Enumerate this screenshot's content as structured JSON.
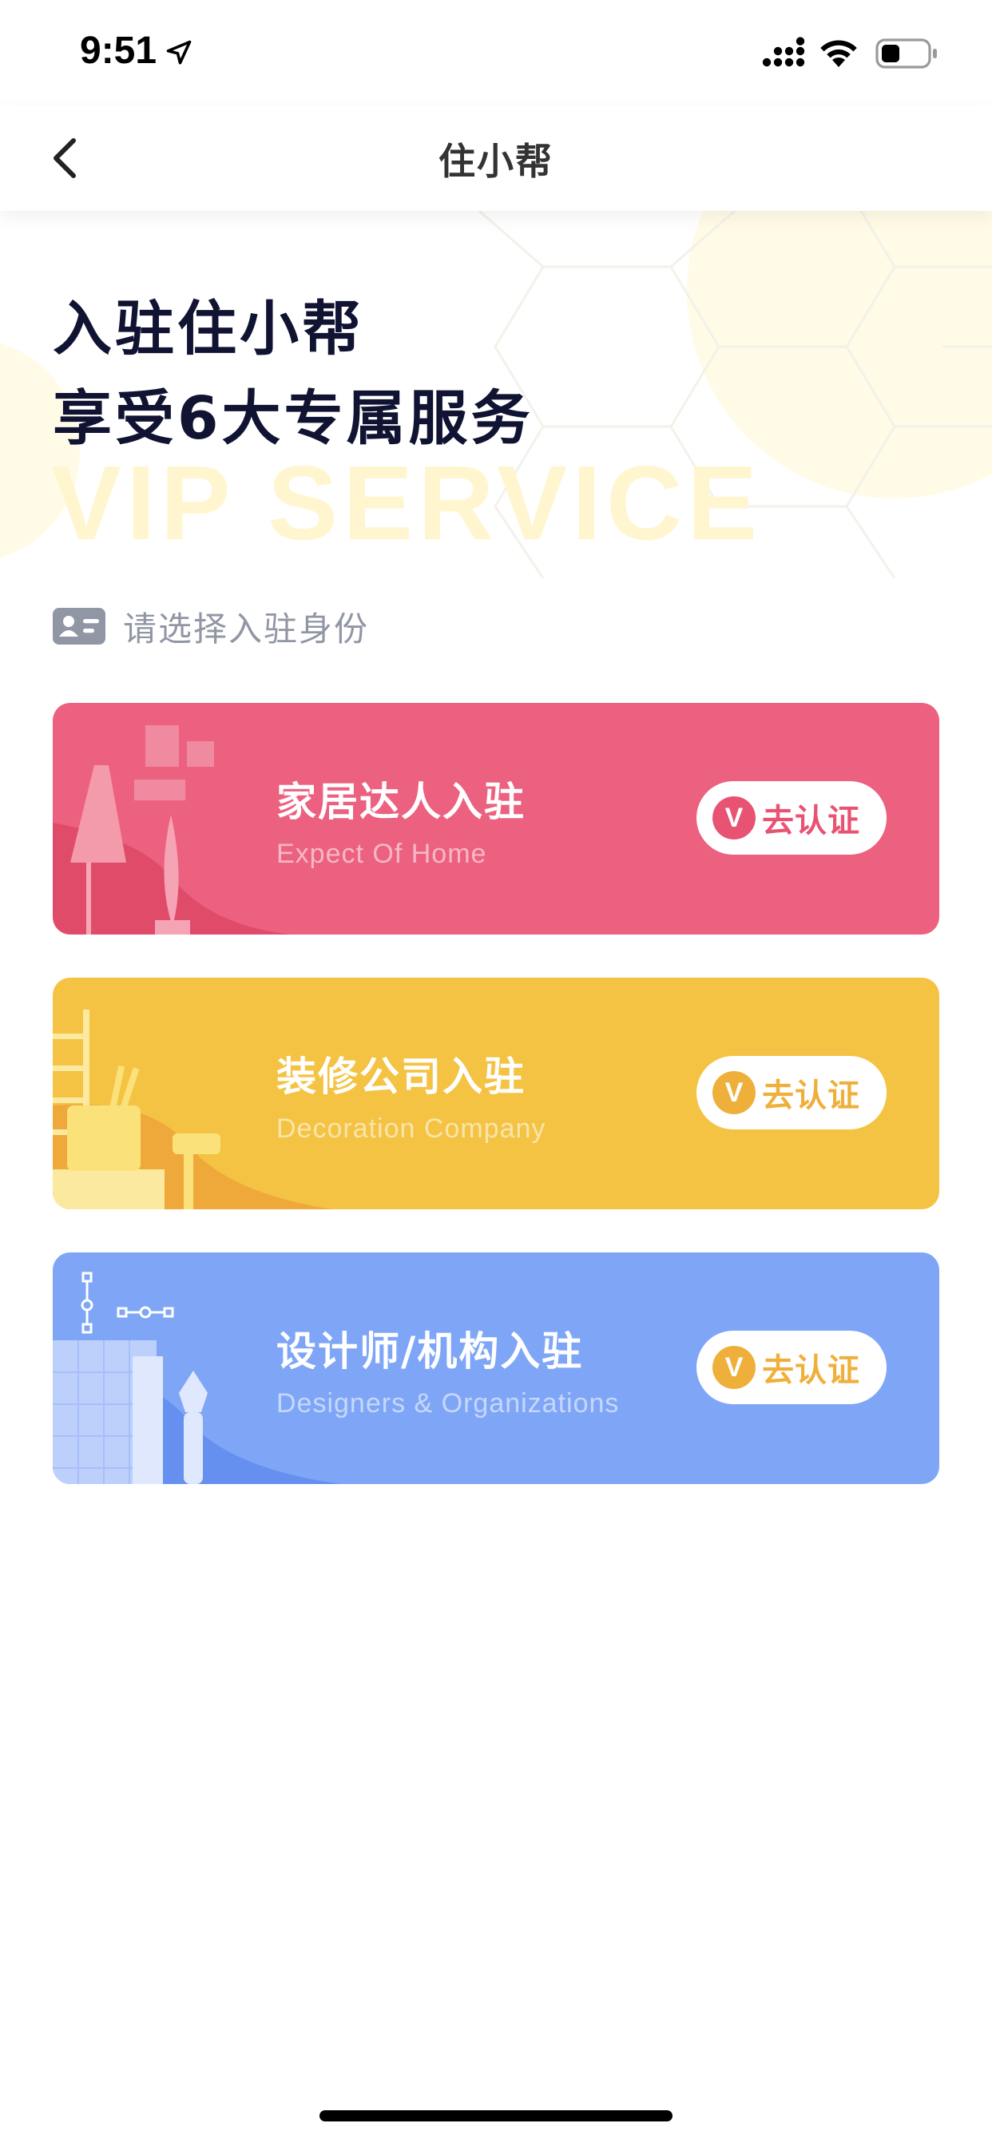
{
  "status_bar": {
    "time": "9:51"
  },
  "nav": {
    "title": "住小帮"
  },
  "hero": {
    "line1": "入驻住小帮",
    "line2": "享受6大专属服务",
    "watermark": "VIP SERVICE"
  },
  "section": {
    "label": "请选择入驻身份"
  },
  "cards": [
    {
      "title": "家居达人入驻",
      "subtitle": "Expect Of Home",
      "button_label": "去认证",
      "badge_letter": "V",
      "color": "#ec6180",
      "badge_color": "#e95373",
      "button_text_color": "#e95373"
    },
    {
      "title": "装修公司入驻",
      "subtitle": "Decoration Company",
      "button_label": "去认证",
      "badge_letter": "V",
      "color": "#f4c343",
      "badge_color": "#efb03b",
      "button_text_color": "#efb03b"
    },
    {
      "title": "设计师/机构入驻",
      "subtitle": "Designers & Organizations",
      "button_label": "去认证",
      "badge_letter": "V",
      "color": "#7fa6f6",
      "badge_color": "#efb03b",
      "button_text_color": "#efb03b"
    }
  ],
  "colors": {
    "title": "#101432",
    "accent_pink": "#ec6180",
    "accent_yellow": "#f4c343",
    "accent_blue": "#7fa6f6",
    "label_gray": "#9096a4"
  }
}
